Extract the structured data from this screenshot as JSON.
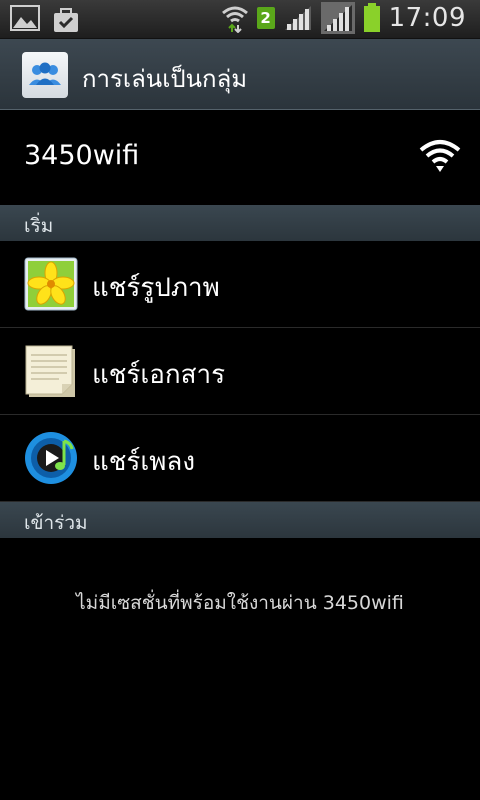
{
  "status_bar": {
    "sim_badge": "2",
    "time": "17:09",
    "icons": [
      "gallery-icon",
      "check-bag-icon",
      "wifi-transfer-icon",
      "signal-icon",
      "signal-icon",
      "battery-icon"
    ]
  },
  "action_bar": {
    "title": "การเล่นเป็นกลุ่ม",
    "icon": "group-play-icon"
  },
  "network": {
    "name": "3450wifi",
    "icon": "wifi-icon"
  },
  "sections": {
    "start": "เริ่ม",
    "join": "เข้าร่วม"
  },
  "start_items": [
    {
      "label": "แชร์รูปภาพ",
      "icon": "image-icon"
    },
    {
      "label": "แชร์เอกสาร",
      "icon": "document-icon"
    },
    {
      "label": "แชร์เพลง",
      "icon": "music-icon"
    }
  ],
  "join_empty_message": "ไม่มีเซสชั่นที่พร้อมใช้งานผ่าน 3450wifi",
  "colors": {
    "accent_green": "#5aa71a",
    "header_bg": "#3d4851",
    "background": "#000000"
  }
}
